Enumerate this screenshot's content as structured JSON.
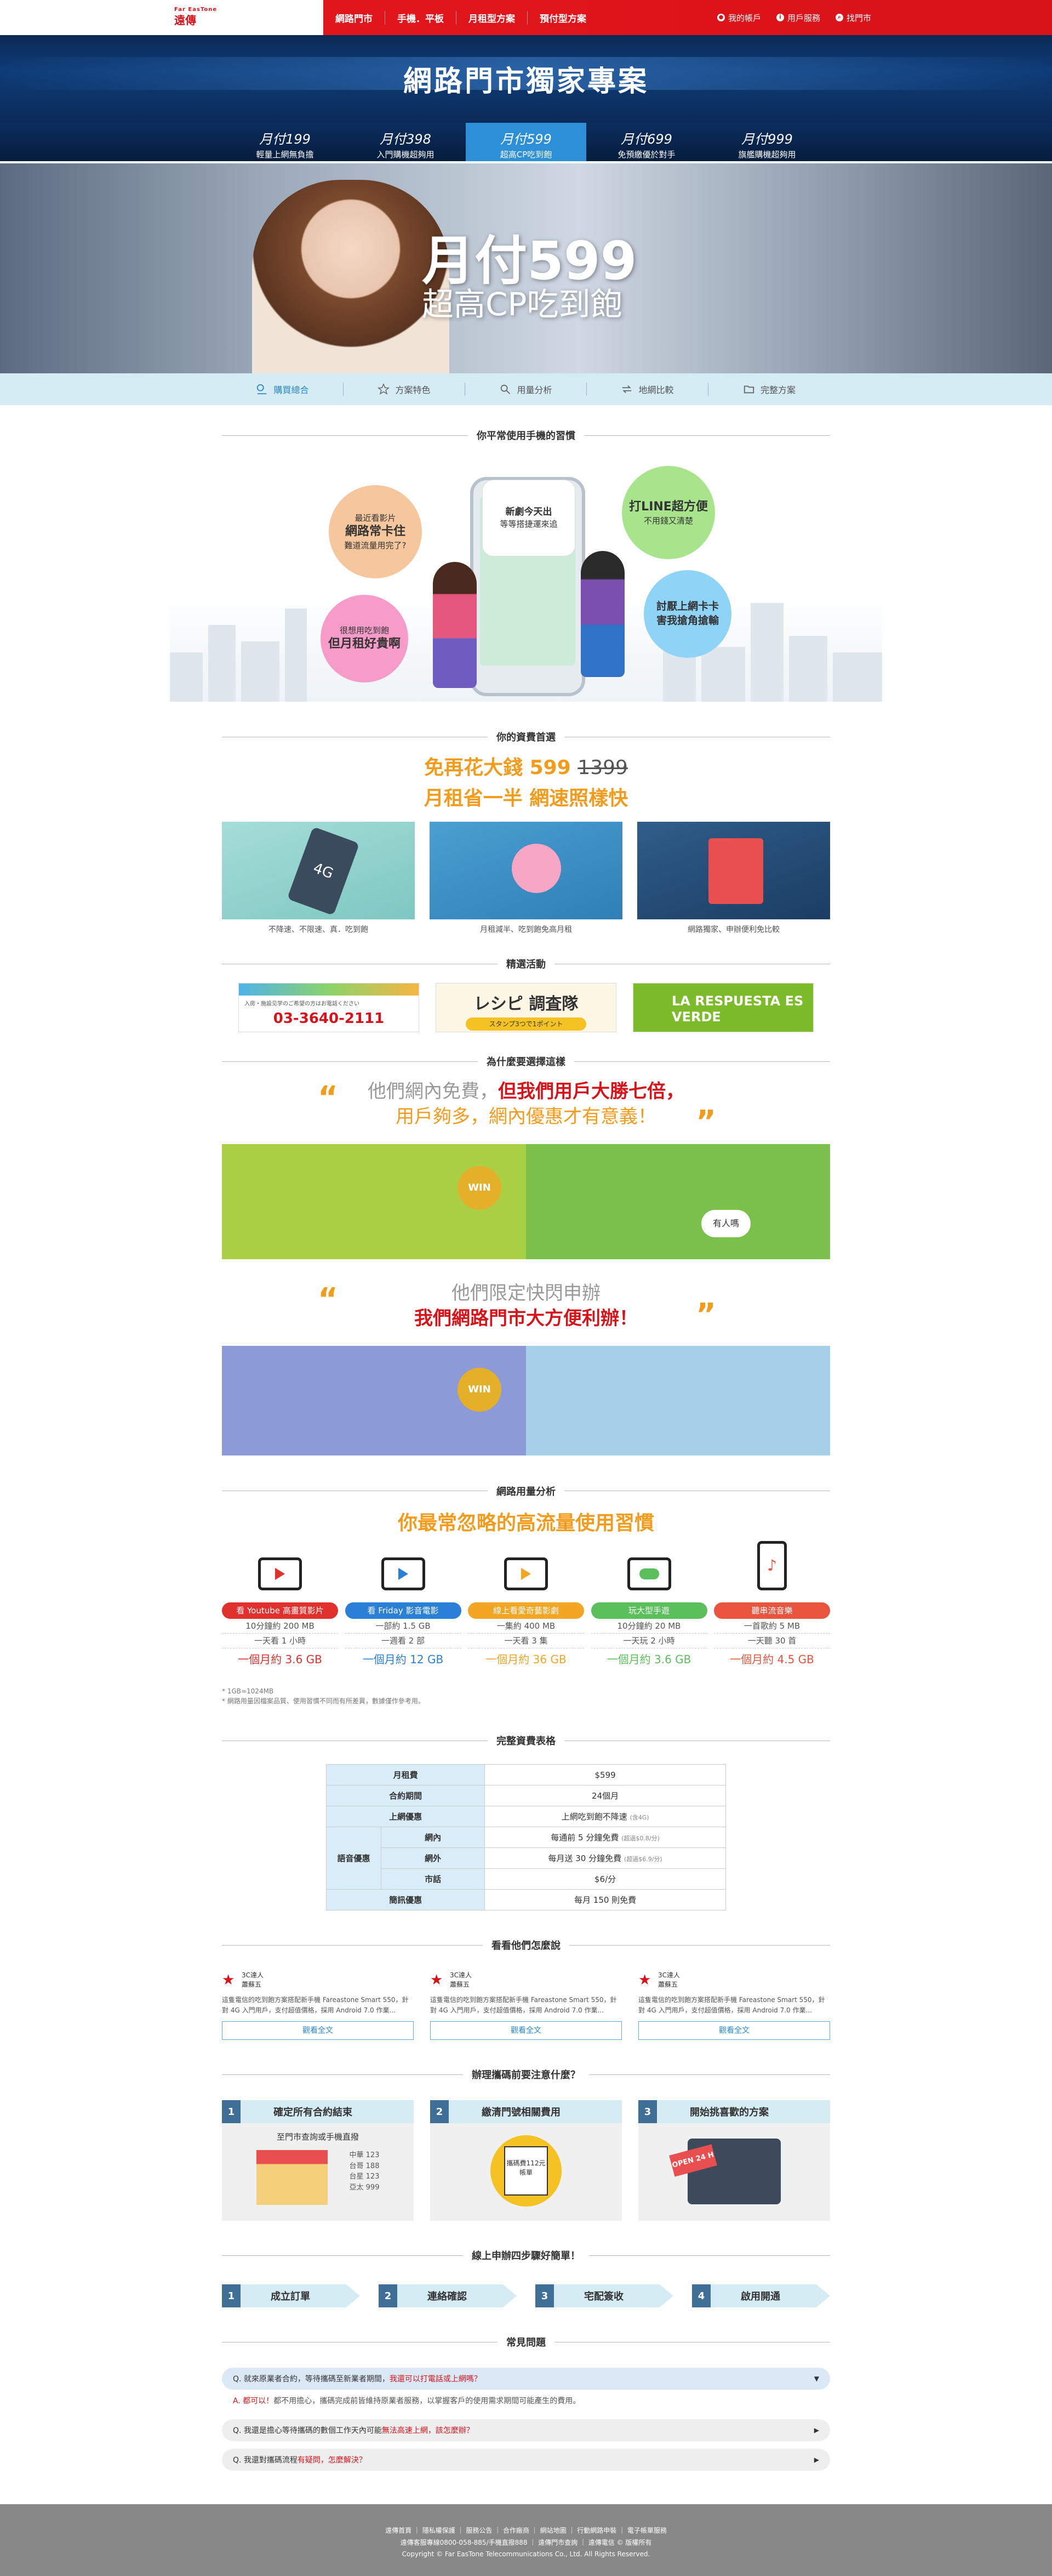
{
  "brand": {
    "logo_line1": "Far EasTone",
    "logo_line2": "遠傳"
  },
  "topnav": {
    "items": [
      "網路門市",
      "手機．平板",
      "月租型方案",
      "預付型方案"
    ],
    "right": [
      "我的帳戶",
      "用戶服務",
      "找門市"
    ]
  },
  "header": {
    "title": "網路門市獨家專案",
    "plans": [
      {
        "price": "月付199",
        "desc": "輕量上網無負擔"
      },
      {
        "price": "月付398",
        "desc": "入門購機超夠用"
      },
      {
        "price": "月付599",
        "desc": "超高CP吃到飽"
      },
      {
        "price": "月付699",
        "desc": "免預繳優於對手"
      },
      {
        "price": "月付999",
        "desc": "旗艦購機超夠用"
      }
    ]
  },
  "hero": {
    "line1": "月付599",
    "line2": "超高CP吃到飽"
  },
  "subnav": [
    "購買總合",
    "方案特色",
    "用量分析",
    "地網比較",
    "完整方案"
  ],
  "habit": {
    "heading": "你平常使用手機的習慣",
    "bubbles": [
      {
        "a": "最近看影片",
        "b": "網路常卡住",
        "c": "難道流量用完了?"
      },
      {
        "a": "新劇今天出",
        "b": "等等搭捷運來追",
        "c": ""
      },
      {
        "a": "",
        "b": "打LINE超方便",
        "c": "不用錢又清楚"
      },
      {
        "a": "很想用吃到飽",
        "b": "但月租好貴啊",
        "c": ""
      },
      {
        "a": "討厭上網卡卡",
        "b": "害我搶角搶輸",
        "c": ""
      }
    ]
  },
  "budget": {
    "heading": "你的資費首選",
    "line1_a": "免再花大錢 599 ",
    "line1_b": "1399",
    "line2": "月租省一半 網速照樣快",
    "cards": [
      "不降速、不限速、真．吃到飽",
      "月租減半、吃到飽免高月租",
      "網路獨家、申辦便利免比較"
    ]
  },
  "events": {
    "heading": "精選活動",
    "promo1_tel": "03-3640-2111",
    "promo1_txt": "入房・施設见学のご希望の方はお電話ください",
    "promo2": "レシピ 調査隊",
    "promo2b": "スタンプ3つで1ポイント",
    "promo3": "LA RESPUESTA ES VERDE"
  },
  "why": {
    "heading": "為什麼要選擇這樣",
    "q1_a": "他們網內免費，",
    "q1_b": "但我們用戶大勝七倍，",
    "q1_c": "用戶夠多，網內優惠才有意義！",
    "q2_a": "他們限定快閃申辦",
    "q2_b": "我們網路門市大方便利辦！",
    "win": "WIN",
    "who": "有人嗎"
  },
  "usage": {
    "heading": "網路用量分析",
    "title": "你最常忽略的高流量使用習慣",
    "items": [
      {
        "label": "看 Youtube 高畫質影片",
        "d1": "10分鐘約 200 MB",
        "d2": "一天看 1 小時",
        "m": "一個月約 3.6 GB",
        "color": "#e0312e"
      },
      {
        "label": "看 Friday 影音電影",
        "d1": "一部約 1.5 GB",
        "d2": "一週看 2 部",
        "m": "一個月約 12 GB",
        "color": "#2a7fd6"
      },
      {
        "label": "線上看愛奇藝影劇",
        "d1": "一集約 400 MB",
        "d2": "一天看 3 集",
        "m": "一個月約 36 GB",
        "color": "#f2a623"
      },
      {
        "label": "玩大型手遊",
        "d1": "10分鐘約 20 MB",
        "d2": "一天玩 2 小時",
        "m": "一個月約 3.6 GB",
        "color": "#5bbf5b"
      },
      {
        "label": "聽串流音樂",
        "d1": "一首歌約 5 MB",
        "d2": "一天聽 30 首",
        "m": "一個月約 4.5 GB",
        "color": "#e8543e"
      }
    ],
    "notes": [
      "* 1GB=1024MB",
      "* 網路用量因檔案品質、使用習慣不同而有所差異，數據僅作參考用。"
    ]
  },
  "table": {
    "heading": "完整資費表格",
    "rows": [
      {
        "k": "月租費",
        "v": "$599"
      },
      {
        "k": "合約期間",
        "v": "24個月"
      },
      {
        "k": "上網優惠",
        "v": "上網吃到飽不降速",
        "n": "(含4G)"
      },
      {
        "k": "網內",
        "v": "每通前 5 分鐘免費",
        "n": "(超過$0.8/分)"
      },
      {
        "k": "網外",
        "v": "每月送 30 分鐘免費",
        "n": "(超過$6.9/分)"
      },
      {
        "k": "市話",
        "v": "$6/分"
      },
      {
        "k": "簡訊優惠",
        "v": "每月 150 則免費"
      }
    ],
    "group": "語音優惠"
  },
  "reviews": {
    "heading": "看看他們怎麼說",
    "items": [
      {
        "who": "3C達人",
        "name": "蕭蘇五",
        "text": "這隻電信的吃到飽方案搭配新手機 Fareastone Smart 550，針對 4G 入門用戶，支付超值價格，採用 Android 7.0 作業...",
        "btn": "觀看全文"
      },
      {
        "who": "3C達人",
        "name": "蕭蘇五",
        "text": "這隻電信的吃到飽方案搭配新手機 Fareastone Smart 550，針對 4G 入門用戶，支付超值價格，採用 Android 7.0 作業...",
        "btn": "觀看全文"
      },
      {
        "who": "3C達人",
        "name": "蕭蘇五",
        "text": "這隻電信的吃到飽方案搭配新手機 Fareastone Smart 550，針對 4G 入門用戶，支付超值價格，採用 Android 7.0 作業...",
        "btn": "觀看全文"
      }
    ]
  },
  "notice": {
    "heading": "辦理攜碼前要注意什麼？",
    "items": [
      {
        "n": "1",
        "t": "確定所有合約結束",
        "s": "至門市查詢或手機直撥",
        "box": [
          "中華 123",
          "台哥 188",
          "台星 123",
          "亞太 999"
        ]
      },
      {
        "n": "2",
        "t": "繳清門號相關費用",
        "s": "攜碼費112元 帳單"
      },
      {
        "n": "3",
        "t": "開始挑喜歡的方案",
        "s": "OPEN 24 H"
      }
    ]
  },
  "steps": {
    "heading": "線上申辦四步驟好簡單！",
    "items": [
      {
        "n": "1",
        "t": "成立訂單"
      },
      {
        "n": "2",
        "t": "連絡確認"
      },
      {
        "n": "3",
        "t": "宅配簽收"
      },
      {
        "n": "4",
        "t": "啟用開通"
      }
    ]
  },
  "faq": {
    "heading": "常見問題",
    "items": [
      {
        "pre": "Q. 就來原業者合約，等待攜碼至新業者期間，",
        "hl": "我還可以打電話或上網嗎？",
        "post": ""
      },
      {
        "pre": "Q. 我還是擔心等待攜碼的數個工作天內可能",
        "hl": "無法高速上網，該怎麼辦？",
        "post": ""
      },
      {
        "pre": "Q. 我還對攜碼流程",
        "hl": "有疑問，怎麼解決？",
        "post": ""
      }
    ],
    "answer_a": "A. 都可以！",
    "answer": "都不用擔心，攜碼完成前皆維持原業者服務，以掌握客戶的使用需求期間可能產生的費用。"
  },
  "footer": {
    "links": "遠傳首頁 ｜ 隱私權保護 ｜ 服務公告 ｜ 合作廠商 ｜ 網站地圖 ｜ 行動網路申裝 ｜ 電子帳單服務",
    "l2": "遠傳客服專線0800-058-885/手機直撥888 ｜ 遠傳門市查詢 ｜ 遠傳電信 © 版權所有",
    "l3": "Copyright © Far EasTone Telecommunications Co., Ltd. All Rights Reserved."
  }
}
